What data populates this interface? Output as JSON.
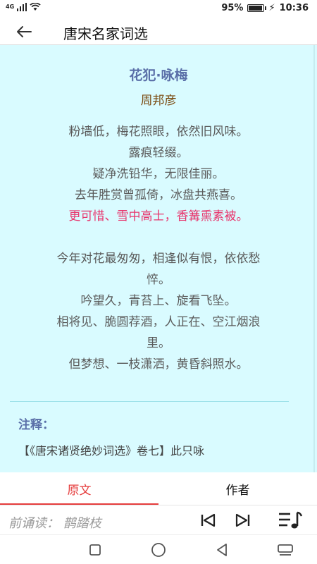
{
  "status_bar": {
    "network": "4G",
    "battery": "95%",
    "battery_level": 0.95,
    "time": "10:36"
  },
  "header": {
    "back_icon": "arrow-left-icon",
    "title": "唐宋名家词选"
  },
  "poem": {
    "title": "花犯·咏梅",
    "author": "周邦彦",
    "lines": [
      "粉墙低，梅花照眼，依然旧风味。",
      "露痕轻缀。",
      "疑净洗铅华，无限佳丽。",
      "去年胜赏曾孤倚，冰盘共燕喜。",
      "更可惜、雪中高士，香篝熏素被。",
      "",
      "今年对花最匆匆，相逢似有恨，依依愁",
      "悴。",
      "吟望久，青苔上、旋看飞坠。",
      "相将见、脆圆荐酒，人正在、空江烟浪",
      "里。",
      "但梦想、一枝潇洒，黄昏斜照水。"
    ],
    "highlight_line_index": 4,
    "note_label": "注释：",
    "note_text": "【《唐宋诸贤绝妙词选》卷七】此只咏"
  },
  "tabs": [
    {
      "label": "原文",
      "active": true
    },
    {
      "label": "作者",
      "active": false
    }
  ],
  "player": {
    "now_playing": "前诵读：  鹊踏枝",
    "prev_icon": "skip-previous-icon",
    "next_icon": "skip-next-icon",
    "playlist_icon": "playlist-music-icon"
  },
  "colors": {
    "content_bg": "#d9fbff",
    "title": "#5a6fa8",
    "author": "#7a4a10",
    "highlight": "#e8336b",
    "active_tab": "#e53b3b"
  }
}
